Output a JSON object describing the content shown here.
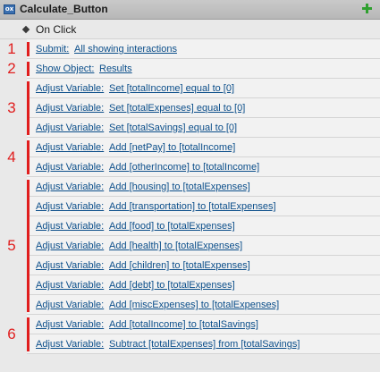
{
  "panel": {
    "title": "Calculate_Button",
    "icon": "widget-icon",
    "add_icon": "plus-icon"
  },
  "event": {
    "label": "On Click",
    "icon": "diamond-icon"
  },
  "groups": [
    {
      "number": "1",
      "actions": [
        {
          "label": "Submit:",
          "value": "All showing interactions"
        }
      ]
    },
    {
      "number": "2",
      "actions": [
        {
          "label": "Show Object:",
          "value": "Results"
        }
      ]
    },
    {
      "number": "3",
      "actions": [
        {
          "label": "Adjust Variable:",
          "value": "Set [totalIncome] equal to [0]"
        },
        {
          "label": "Adjust Variable:",
          "value": "Set [totalExpenses] equal to [0]"
        },
        {
          "label": "Adjust Variable:",
          "value": "Set [totalSavings] equal to [0]"
        }
      ]
    },
    {
      "number": "4",
      "actions": [
        {
          "label": "Adjust Variable:",
          "value": "Add [netPay] to [totalIncome]"
        },
        {
          "label": "Adjust Variable:",
          "value": "Add [otherIncome] to [totalIncome]"
        }
      ]
    },
    {
      "number": "5",
      "actions": [
        {
          "label": "Adjust Variable:",
          "value": "Add [housing] to [totalExpenses]"
        },
        {
          "label": "Adjust Variable:",
          "value": "Add [transportation] to [totalExpenses]"
        },
        {
          "label": "Adjust Variable:",
          "value": "Add [food] to [totalExpenses]"
        },
        {
          "label": "Adjust Variable:",
          "value": "Add [health] to [totalExpenses]"
        },
        {
          "label": "Adjust Variable:",
          "value": "Add [children] to [totalExpenses]"
        },
        {
          "label": "Adjust Variable:",
          "value": "Add [debt] to [totalExpenses]"
        },
        {
          "label": "Adjust Variable:",
          "value": "Add [miscExpenses] to [totalExpenses]"
        }
      ]
    },
    {
      "number": "6",
      "actions": [
        {
          "label": "Adjust Variable:",
          "value": "Add [totalIncome] to [totalSavings]"
        },
        {
          "label": "Adjust Variable:",
          "value": "Subtract [totalExpenses] from [totalSavings]"
        }
      ]
    }
  ],
  "colors": {
    "accent": "#e01e1e",
    "link": "#0b4e8a",
    "add": "#2fa02f"
  }
}
